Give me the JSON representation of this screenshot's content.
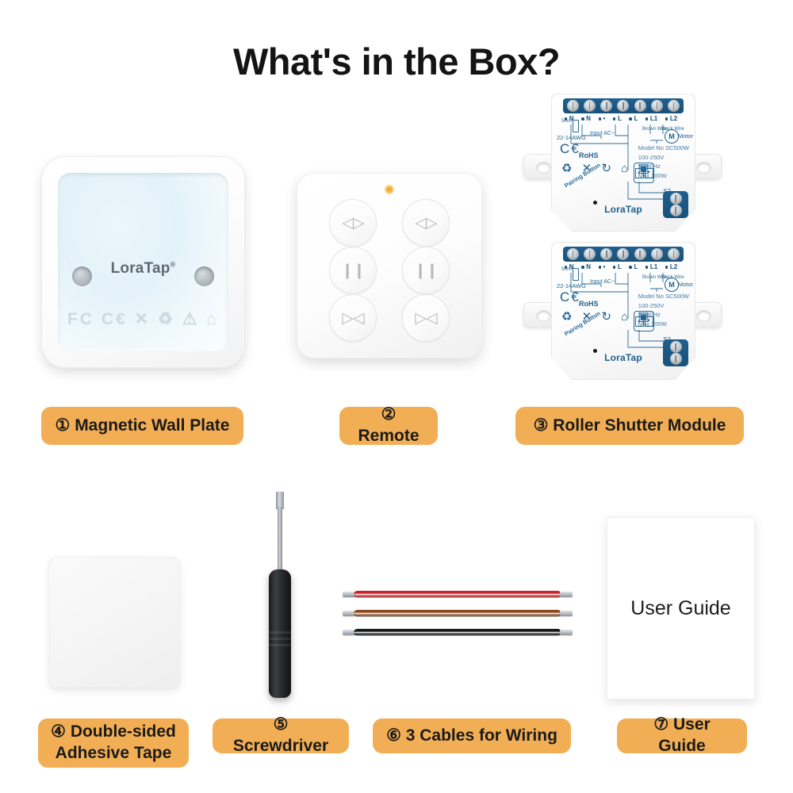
{
  "page": {
    "title": "What's in the Box?",
    "background_color": "#ffffff",
    "badge_color": "#F2AE55",
    "brand": "LoraTap"
  },
  "items": [
    {
      "number": "①",
      "label": "① Magnetic Wall Plate",
      "name": "magnetic-wall-plate",
      "brand_text": "LoraTap",
      "cert_marks": "FC C€ ✕ ♻ ⚠ ⌂"
    },
    {
      "number": "②",
      "label": "② Remote",
      "name": "remote",
      "led": "indicator-led",
      "buttons": [
        {
          "icon": "◁▷",
          "name": "open-button-left"
        },
        {
          "icon": "◁▷",
          "name": "open-button-right"
        },
        {
          "icon": "❙❙",
          "name": "pause-button-left"
        },
        {
          "icon": "❙❙",
          "name": "pause-button-right"
        },
        {
          "icon": "▷◁",
          "name": "close-button-left"
        },
        {
          "icon": "▷◁",
          "name": "close-button-right"
        }
      ]
    },
    {
      "number": "③",
      "label": "③ Roller Shutter Module",
      "name": "roller-shutter-module",
      "quantity": 2,
      "board": {
        "brand": "LoraTap",
        "model": "Model No SC500W",
        "voltage": "100-250V",
        "frequency": "50/60Hz",
        "power": "Max 300W",
        "terminal_pins": [
          "N",
          "N",
          "•",
          "L",
          "L",
          "L1",
          "L2"
        ],
        "input_label": "Input AC~",
        "motor_label": "Motor",
        "motor_symbol": "M",
        "brown_wire": "Brown\nWire",
        "black_wire": "Black\nWire",
        "fuse_top": "5mm",
        "fuse_bottom": "22-14AWG",
        "pairing_button": "Pairing Button",
        "switch_s1": "S1",
        "switch_s2": "S2",
        "certs": "C€",
        "rohs": "RoHS",
        "icons": "♻ ✕ ↻ ⌂ ▣"
      }
    },
    {
      "number": "④",
      "label": "④ Double-sided\nAdhesive Tape",
      "name": "double-sided-adhesive-tape"
    },
    {
      "number": "⑤",
      "label": "⑤ Screwdriver",
      "name": "screwdriver"
    },
    {
      "number": "⑥",
      "label": "⑥ 3 Cables for Wiring",
      "name": "cables-for-wiring",
      "cables": [
        {
          "color": "#c8242c",
          "name": "red-cable"
        },
        {
          "color": "#8a4a21",
          "name": "brown-cable"
        },
        {
          "color": "#17181a",
          "name": "black-cable"
        }
      ]
    },
    {
      "number": "⑦",
      "label": "⑦ User Guide",
      "name": "user-guide",
      "cover_text": "User Guide"
    }
  ]
}
